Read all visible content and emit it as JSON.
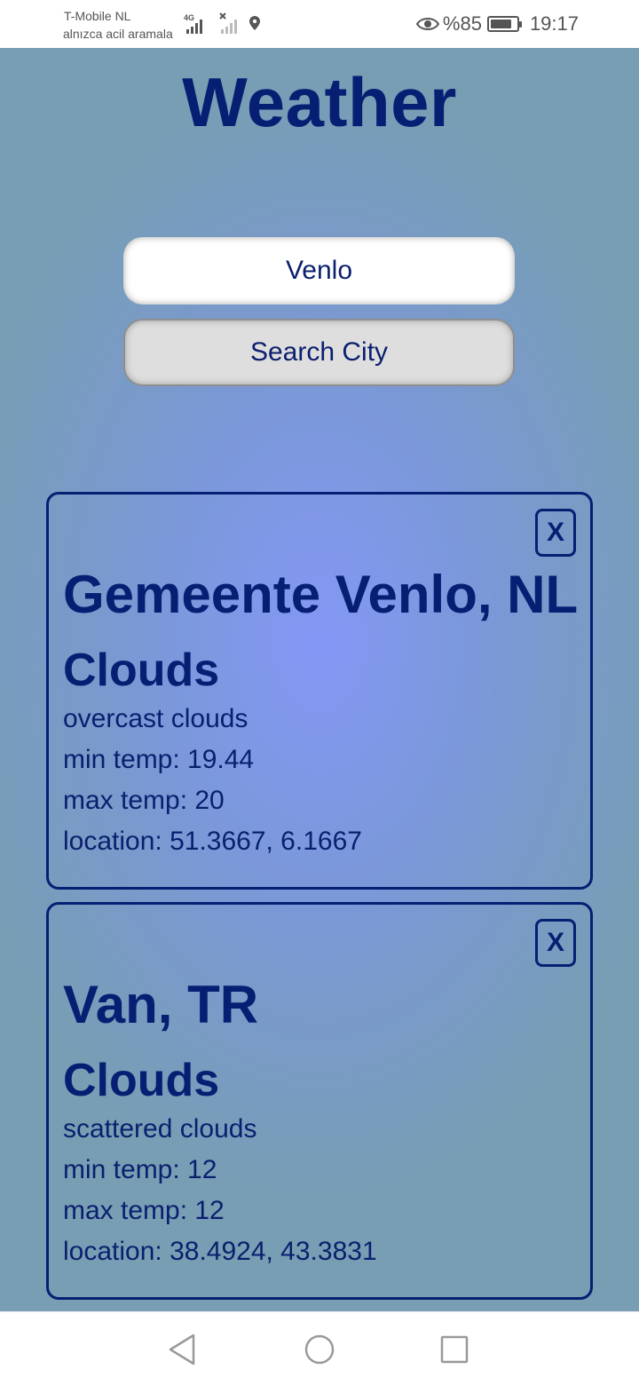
{
  "status_bar": {
    "carrier": "T-Mobile  NL",
    "carrier_sub": "alnızca acil aramala",
    "network": "4G",
    "battery_text": "%85",
    "battery_level": 0.85,
    "time": "19:17",
    "icons": [
      "signal-icon",
      "no-signal-icon",
      "location-icon",
      "eye-icon",
      "battery-icon"
    ]
  },
  "app": {
    "title": "Weather",
    "search": {
      "value": "Venlo",
      "button_label": "Search City"
    },
    "cards": [
      {
        "close_label": "X",
        "city": "Gemeente Venlo, NL",
        "main": "Clouds",
        "description": "overcast clouds",
        "min_temp": "min temp: 19.44",
        "max_temp": "max temp: 20",
        "location": "location: 51.3667, 6.1667"
      },
      {
        "close_label": "X",
        "city": "Van, TR",
        "main": "Clouds",
        "description": "scattered clouds",
        "min_temp": "min temp: 12",
        "max_temp": "max temp: 12",
        "location": "location: 38.4924, 43.3831"
      }
    ]
  },
  "nav_bar": {
    "icons": [
      "back-icon",
      "home-icon",
      "recents-icon"
    ]
  },
  "colors": {
    "primary_text": "#061f73",
    "background_center": "#8497f5",
    "background_edge": "#779eb3",
    "button_bg": "#dedede"
  }
}
